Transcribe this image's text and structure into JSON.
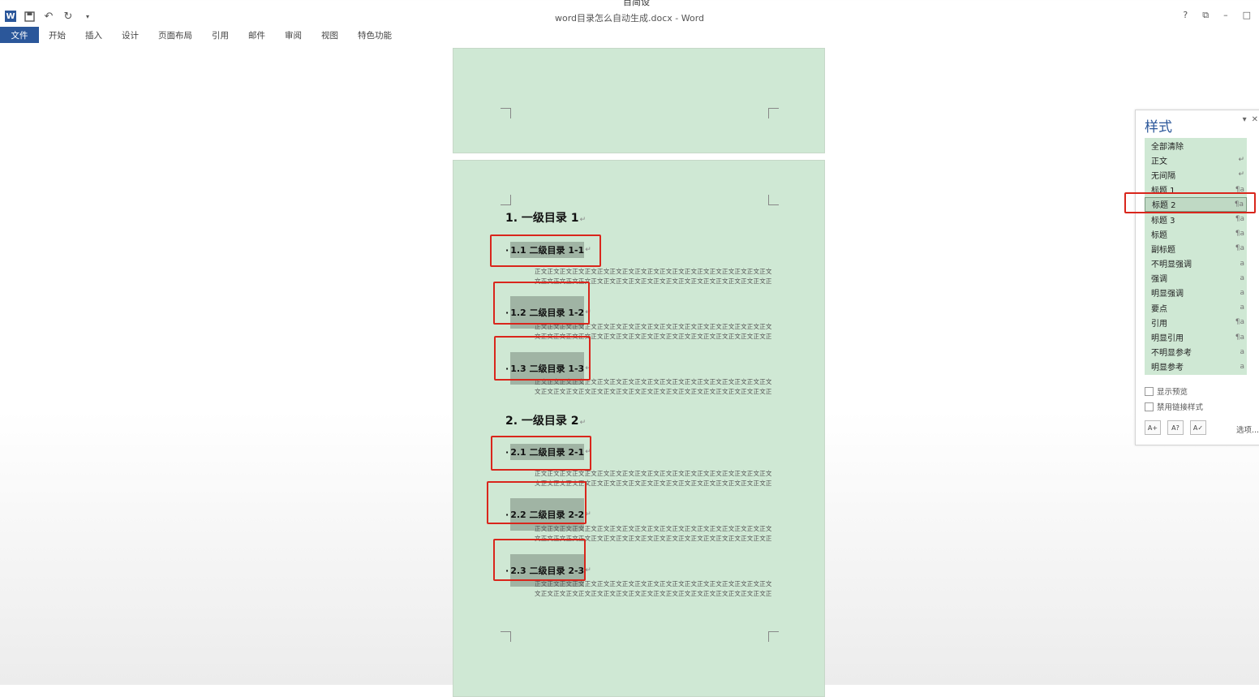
{
  "window": {
    "title": "word目录怎么自动生成.docx - Word",
    "clipped_top_text": "目简设",
    "controls": [
      "?",
      "⧉",
      "–",
      "□"
    ]
  },
  "qat": {
    "app_icon": "W",
    "icons": [
      "word-icon",
      "save-icon",
      "undo-icon",
      "redo-icon",
      "customize-qat-icon"
    ]
  },
  "ribbon": {
    "tabs": [
      "文件",
      "开始",
      "插入",
      "设计",
      "页面布局",
      "引用",
      "邮件",
      "审阅",
      "视图",
      "特色功能"
    ]
  },
  "document": {
    "page_color": "#cfe8d4",
    "heading1": [
      "1. 一级目录 1",
      "2. 一级目录 2"
    ],
    "heading2": [
      "1.1 二级目录 1-1",
      "1.2 二级目录 1-2",
      "1.3 二级目录 1-3",
      "2.1 二级目录 2-1",
      "2.2 二级目录 2-2",
      "2.3 二级目录 2-3"
    ],
    "paragraph_mark": "↵",
    "body_line1": "正文正文正文正文正文正文正文正文正文正文正文正文正文正文正文正文正文正文正文正文正文正文正文正文正文正文正文正文正文",
    "body_line2": "文正文正文正文正文正文正文正文正文正文正文正文正文正文正文正文正文正文正文正文正文正文正文正文正文正文正文。",
    "highlight_color": "#d9261c"
  },
  "styles_pane": {
    "title": "样式",
    "items": [
      {
        "label": "全部清除",
        "mark": ""
      },
      {
        "label": "正文",
        "mark": "↵"
      },
      {
        "label": "无间隔",
        "mark": "↵"
      },
      {
        "label": "标题 1",
        "mark": "¶a"
      },
      {
        "label": "标题 2",
        "mark": "¶a"
      },
      {
        "label": "标题 3",
        "mark": "¶a"
      },
      {
        "label": "标题",
        "mark": "¶a"
      },
      {
        "label": "副标题",
        "mark": "¶a"
      },
      {
        "label": "不明显强调",
        "mark": "a"
      },
      {
        "label": "强调",
        "mark": "a"
      },
      {
        "label": "明显强调",
        "mark": "a"
      },
      {
        "label": "要点",
        "mark": "a"
      },
      {
        "label": "引用",
        "mark": "¶a"
      },
      {
        "label": "明显引用",
        "mark": "¶a"
      },
      {
        "label": "不明显参考",
        "mark": "a"
      },
      {
        "label": "明显参考",
        "mark": "a"
      }
    ],
    "selected": "标题 2",
    "show_preview": "显示预览",
    "disable_linked": "禁用链接样式",
    "options": "选项..."
  }
}
